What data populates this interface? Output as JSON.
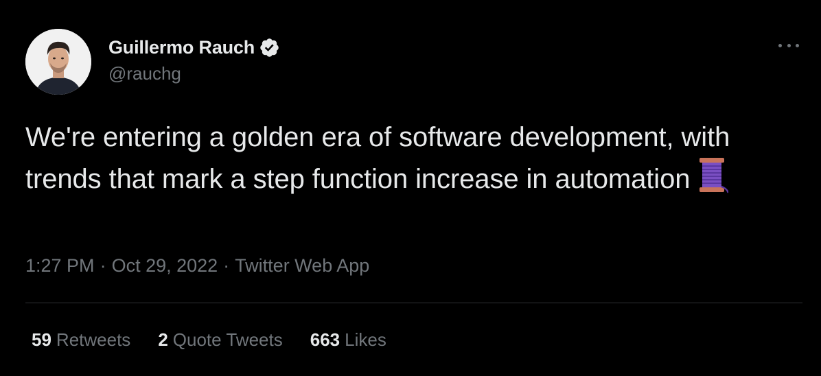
{
  "author": {
    "display_name": "Guillermo Rauch",
    "handle": "@rauchg",
    "verified": true,
    "avatar_icon": "profile-photo"
  },
  "tweet": {
    "text": "We're entering a golden era of software development, with trends that mark a step function increase in automation",
    "emoji": "spool-of-thread-emoji"
  },
  "meta": {
    "time": "1:27 PM",
    "separator": "·",
    "date": "Oct 29, 2022",
    "source": "Twitter Web App"
  },
  "stats": [
    {
      "count": "59",
      "label": "Retweets"
    },
    {
      "count": "2",
      "label": "Quote Tweets"
    },
    {
      "count": "663",
      "label": "Likes"
    }
  ],
  "colors": {
    "background": "#000000",
    "text_primary": "#e7e9ea",
    "text_secondary": "#71767b",
    "divider": "#2f3336"
  }
}
